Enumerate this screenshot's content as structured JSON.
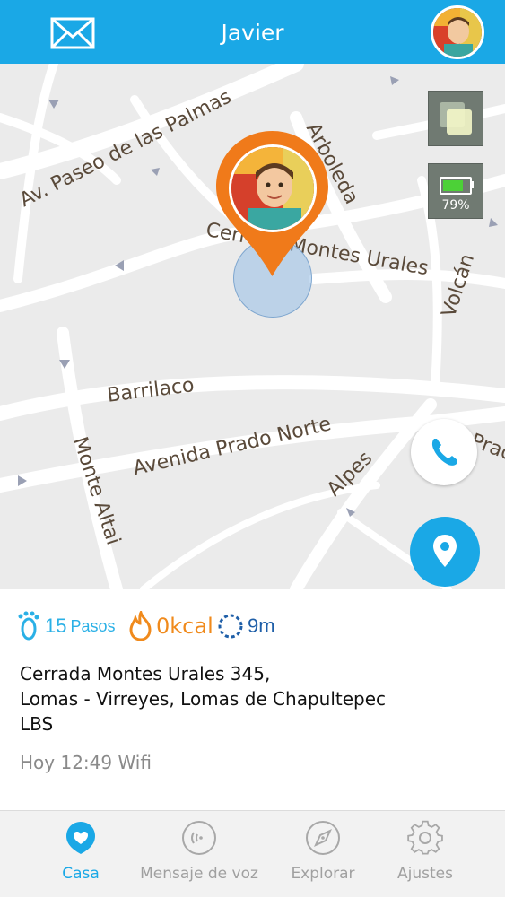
{
  "header": {
    "title": "Javier",
    "accent": "#1aa8e6"
  },
  "map": {
    "streets": [
      "Av. Paseo de las Palmas",
      "Arboleda",
      "Cerrada Montes Urales",
      "Volcán",
      "Barrilaco",
      "Avenida Prado Norte",
      "Monte Altai",
      "Alpes",
      "Prado"
    ],
    "battery_percent": "79%",
    "battery_level": 0.79,
    "icons": [
      "layers-icon",
      "battery-icon",
      "phone-icon",
      "location-pin-icon"
    ]
  },
  "info": {
    "steps_value": "15",
    "steps_label": "Pasos",
    "kcal_value": "0kcal",
    "distance_value": "9m",
    "address_line1": "Cerrada Montes Urales 345,",
    "address_line2": "Lomas - Virreyes, Lomas de Chapultepec",
    "address_line3": "LBS",
    "time_line": "Hoy 12:49 Wifi"
  },
  "tabs": [
    {
      "label": "Casa",
      "icon": "home-heart-icon",
      "active": true
    },
    {
      "label": "Mensaje de voz",
      "icon": "voice-message-icon",
      "active": false
    },
    {
      "label": "Explorar",
      "icon": "compass-icon",
      "active": false
    },
    {
      "label": "Ajustes",
      "icon": "gear-icon",
      "active": false
    }
  ],
  "colors": {
    "pin": "#f07a1a",
    "kcal": "#f08a1c",
    "steps": "#2ab0e6",
    "distance": "#1f5fa8",
    "battery_fill": "#4cd137"
  }
}
